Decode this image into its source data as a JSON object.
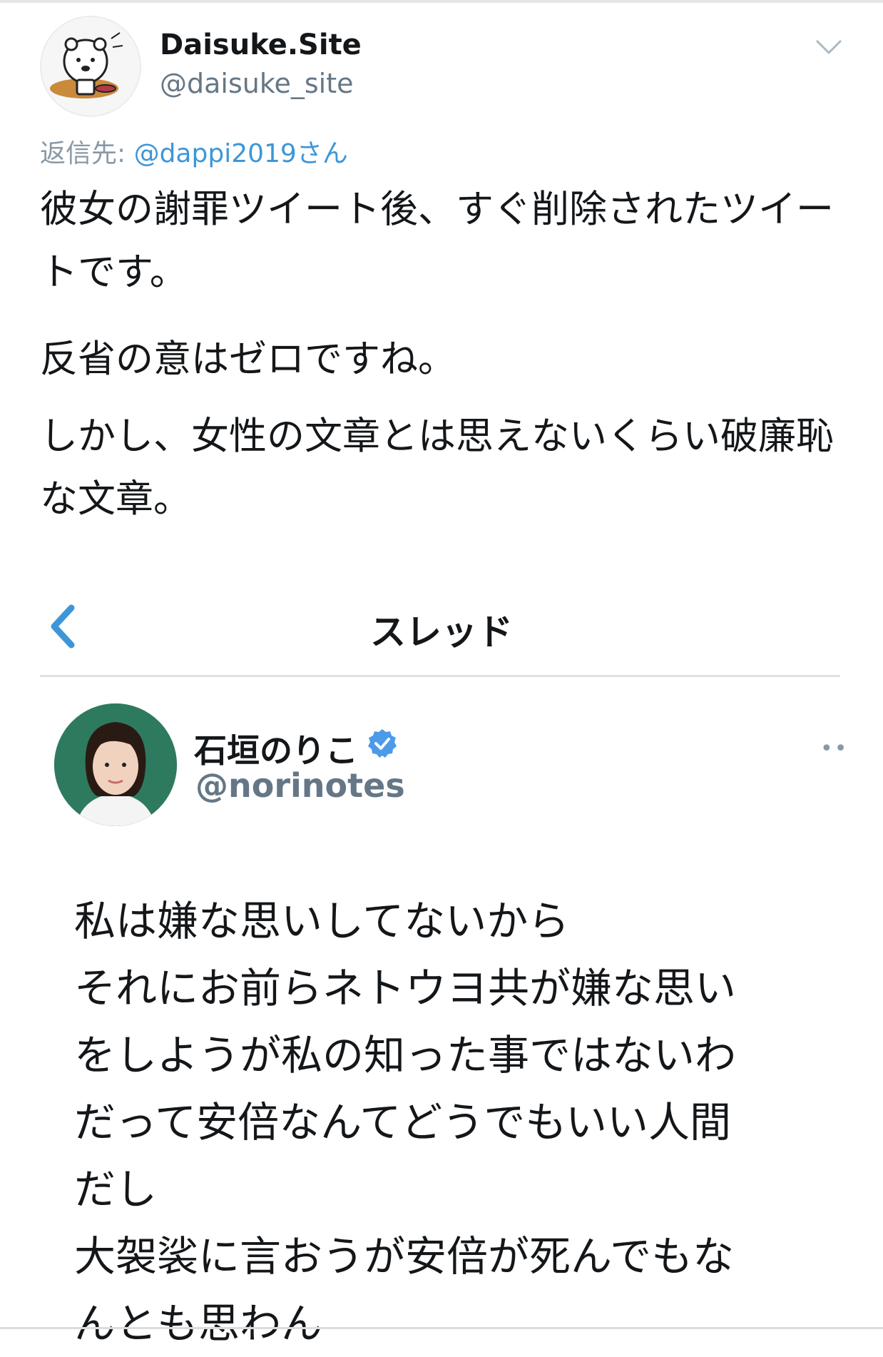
{
  "tweet": {
    "display_name": "Daisuke.Site",
    "handle": "@daisuke_site",
    "reply_prefix": "返信先: ",
    "reply_mention": "@dappi2019さん",
    "paragraphs": [
      "彼女の謝罪ツイート後、すぐ削除されたツイートです。",
      "反省の意はゼロですね。",
      "しかし、女性の文章とは思えないくらい破廉恥な文章。"
    ],
    "menu_icon": "chevron-down-icon"
  },
  "embedded_screenshot": {
    "title": "スレッド",
    "back_icon": "chevron-left-icon",
    "author_name": "石垣のりこ",
    "author_handle": "@norinotes",
    "verified_icon": "verified-badge-icon",
    "more_icon": "more-dots-icon",
    "more_text": "••",
    "lines": [
      "私は嫌な思いしてないから",
      "それにお前らネトウヨ共が嫌な思い",
      "をしようが私の知った事ではないわ",
      "だって安倍なんてどうでもいい人間",
      "だし",
      "大袈裟に言おうが安倍が死んでもな",
      "んとも思わん"
    ]
  },
  "colors": {
    "link_blue": "#3d96d8",
    "secondary_gray": "#657786",
    "text": "#14171a",
    "verified_blue": "#4b9be8"
  }
}
